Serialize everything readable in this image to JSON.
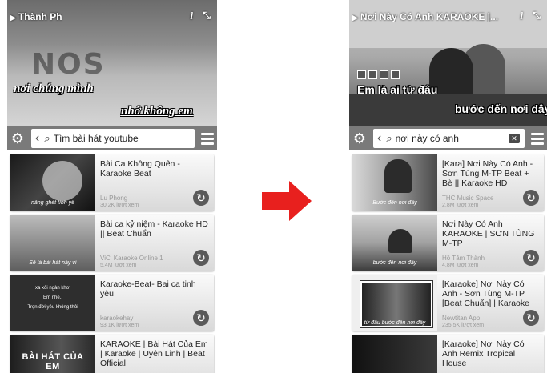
{
  "colors": {
    "arrow": "#e8201e",
    "toolbar": "#7a7a7a",
    "meta_text": "#999999"
  },
  "left": {
    "video_title": "Thành Ph",
    "icons": [
      "play-icon",
      "info-icon",
      "fullscreen-icon"
    ],
    "logo_text": "NOS",
    "lyrics_line_1": "nơi chúng mình",
    "lyrics_line_2": "nhớ không em",
    "search_text": "Tìm bài hát youtube",
    "items": [
      {
        "title": "Bài Ca Không Quên - Karaoke Beat",
        "channel": "Lu Phong",
        "views": "30.2K lượt xem",
        "thumb_caption": "nắng ghét tình yê"
      },
      {
        "title": "Bài ca kỷ niệm - Karaoke HD || Beat Chuẩn",
        "channel": "ViCi Karaoke Online 1",
        "views": "5.4M lượt xem",
        "thumb_caption": "Sẽ là bài hát này vì"
      },
      {
        "title": "Karaoke-Beat- Bai ca tinh yêu",
        "channel": "karaokehay",
        "views": "93.1K lượt xem",
        "thumb_lines": [
          "xa xôi ngàn khơi",
          "Em nhé..",
          "Trọn đời yêu không thôi"
        ]
      },
      {
        "title": "KARAOKE | Bài Hát Của Em | Karaoke | Uyên Linh | Beat Official",
        "thumb_caption": "BÀI HÁT CỦA EM"
      }
    ]
  },
  "right": {
    "video_title": "Nơi Này Có Anh KARAOKE |...",
    "lyrics_line_1": "Em là ai từ đâu",
    "lyrics_line_2": "bước đến nơi đây",
    "search_text": "nơi này có anh",
    "items": [
      {
        "title": "[Kara] Nơi Này Có Anh - Sơn Tùng M-TP Beat + Bè || Karaoke HD",
        "channel": "THC Music Space",
        "views": "2.8M lượt xem",
        "thumb_caption": "Bước đến nơi đây"
      },
      {
        "title": "Nơi Này Có Anh KARAOKE | SƠN TÙNG M-TP",
        "channel": "Hồ Tâm Thành",
        "views": "4.8M lượt xem",
        "thumb_caption": "bước đến nơi đây"
      },
      {
        "title": "[Karaoke] Nơi Này Có Anh - Sơn Tùng M-TP [Beat Chuẩn] | Karaoke HD Newt...",
        "channel": "Newtitan App",
        "views": "235.5K lượt xem",
        "thumb_caption": "từ đâu bước đến nơi đây"
      },
      {
        "title": "[Karaoke] Nơi Này Có Anh Remix Tropical House"
      }
    ]
  }
}
